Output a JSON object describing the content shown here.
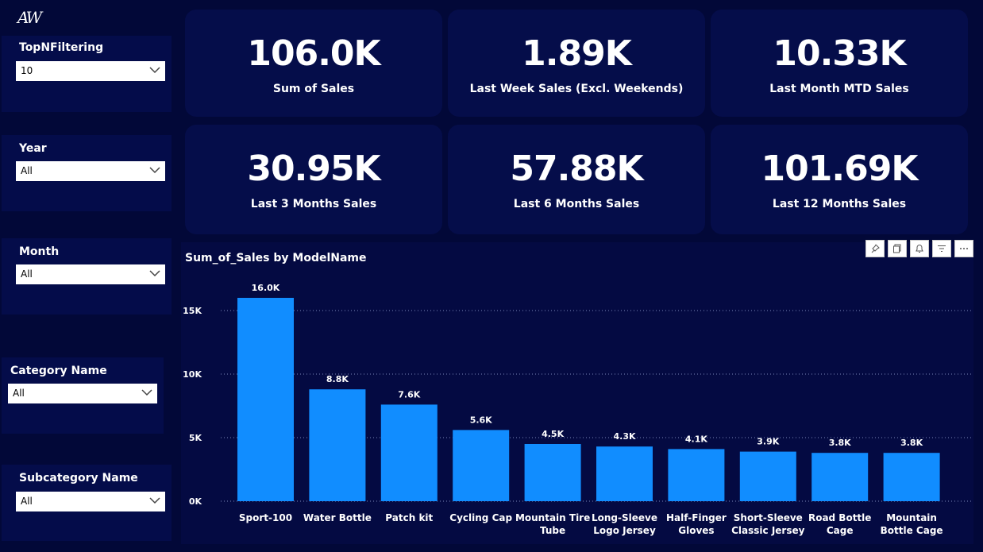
{
  "logo": "AW",
  "slicers": [
    {
      "label": "TopNFiltering",
      "value": "10"
    },
    {
      "label": "Year",
      "value": "All"
    },
    {
      "label": "Month",
      "value": "All"
    },
    {
      "label": "Category Name",
      "value": "All"
    },
    {
      "label": "Subcategory Name",
      "value": "All"
    }
  ],
  "kpis": [
    {
      "value": "106.0K",
      "caption": "Sum of Sales"
    },
    {
      "value": "1.89K",
      "caption": "Last Week Sales (Excl. Weekends)"
    },
    {
      "value": "10.33K",
      "caption": "Last Month MTD Sales"
    },
    {
      "value": "30.95K",
      "caption": "Last 3 Months Sales"
    },
    {
      "value": "57.88K",
      "caption": "Last 6 Months Sales"
    },
    {
      "value": "101.69K",
      "caption": "Last 12 Months Sales"
    }
  ],
  "chart_toolbar": [
    "pin-icon",
    "copy-icon",
    "bell-icon",
    "filter-icon",
    "more-icon"
  ],
  "colors": {
    "background": "#020838",
    "bar": "#118dff",
    "card": "#050d4a"
  },
  "chart_data": {
    "type": "bar",
    "title": "Sum_of_Sales by ModelName",
    "categories": [
      [
        "Sport-100"
      ],
      [
        "Water Bottle"
      ],
      [
        "Patch kit"
      ],
      [
        "Cycling Cap"
      ],
      [
        "Mountain Tire",
        "Tube"
      ],
      [
        "Long-Sleeve",
        "Logo Jersey"
      ],
      [
        "Half-Finger",
        "Gloves"
      ],
      [
        "Short-Sleeve",
        "Classic Jersey"
      ],
      [
        "Road Bottle",
        "Cage"
      ],
      [
        "Mountain",
        "Bottle Cage"
      ]
    ],
    "values": [
      16000,
      8800,
      7600,
      5600,
      4500,
      4300,
      4100,
      3900,
      3800,
      3800
    ],
    "data_labels": [
      "16.0K",
      "8.8K",
      "7.6K",
      "5.6K",
      "4.5K",
      "4.3K",
      "4.1K",
      "3.9K",
      "3.8K",
      "3.8K"
    ],
    "yticks": [
      0,
      5000,
      10000,
      15000
    ],
    "ytick_labels": [
      "0K",
      "5K",
      "10K",
      "15K"
    ],
    "ylim": [
      0,
      15000
    ],
    "grid": true
  }
}
